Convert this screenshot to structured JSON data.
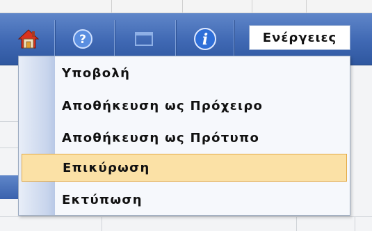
{
  "toolbar": {
    "icons": [
      "home-icon",
      "help-icon",
      "window-icon",
      "info-icon"
    ],
    "actions_label": "Ενέργειες"
  },
  "menu": {
    "items": [
      {
        "label": "Υποβολή",
        "active": false
      },
      {
        "label": "Αποθήκευση ως Πρόχειρο",
        "active": false
      },
      {
        "label": "Αποθήκευση ως Πρότυπο",
        "active": false
      },
      {
        "label": "Επικύρωση",
        "active": true
      },
      {
        "label": "Εκτύπωση",
        "active": false
      }
    ]
  },
  "colors": {
    "toolbar": "#3f68b3",
    "highlight": "#fbe1a6",
    "highlight_border": "#e3a945"
  }
}
